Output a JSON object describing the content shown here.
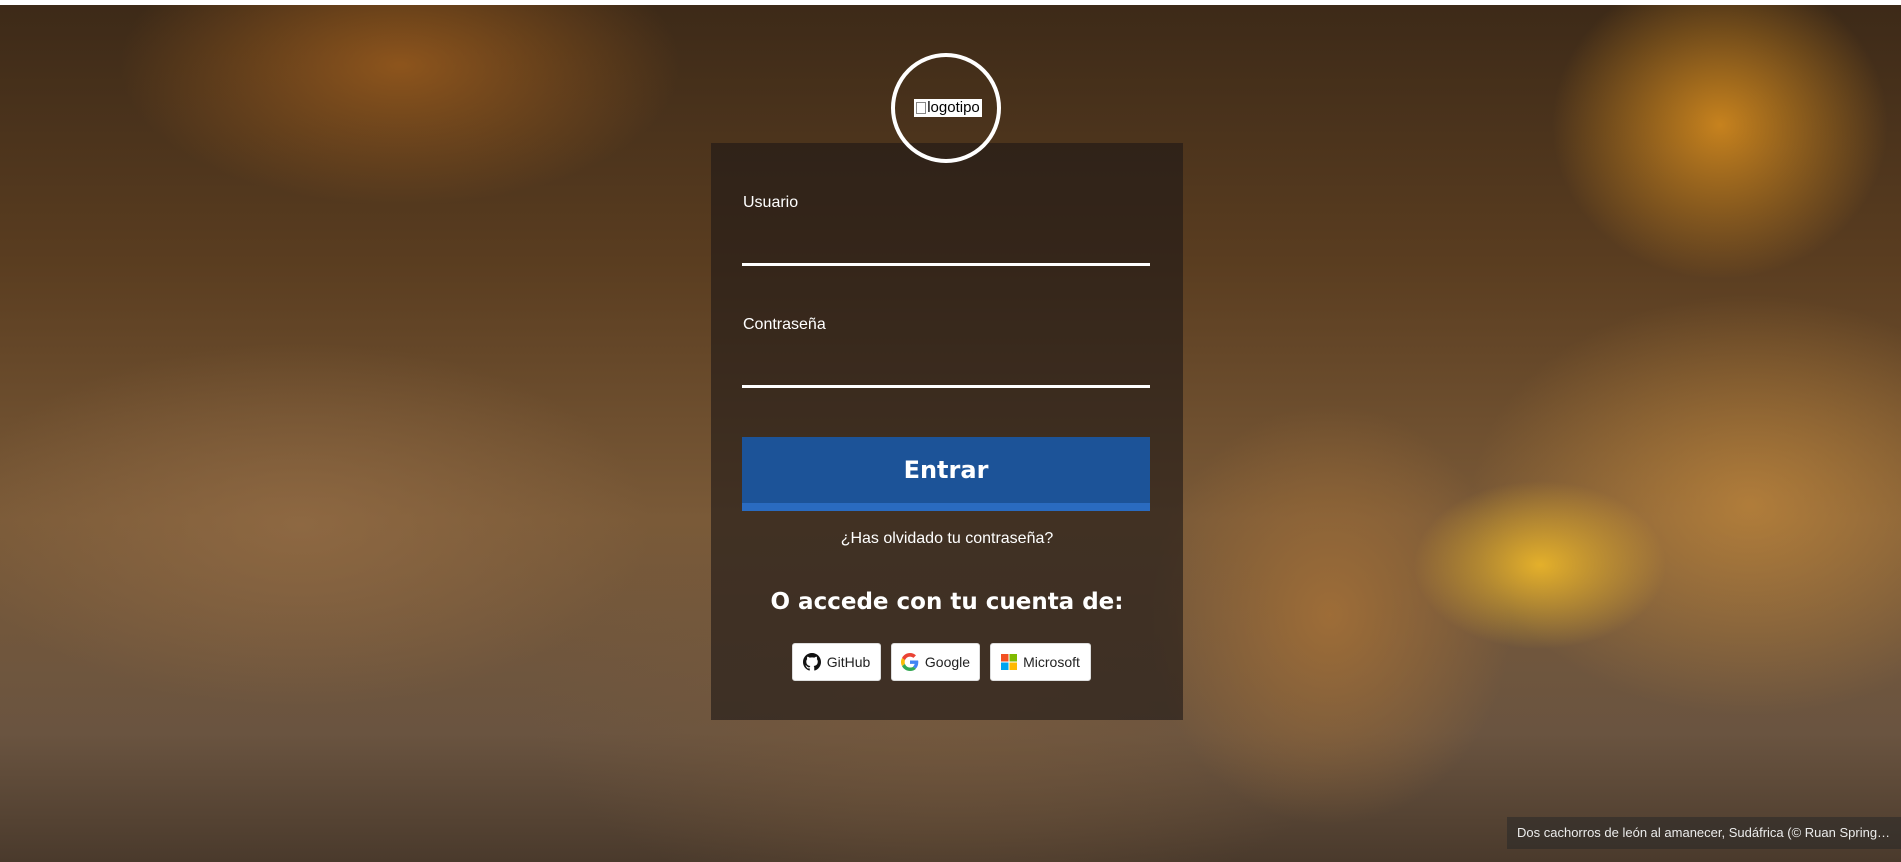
{
  "background": {
    "caption": "Dos cachorros de león al amanecer, Sudáfrica (© Ruan Springor…"
  },
  "logo": {
    "alt_text": "logotipo",
    "icon": "broken-image-icon"
  },
  "form": {
    "username_label": "Usuario",
    "username_value": "",
    "password_label": "Contraseña",
    "password_value": "",
    "submit_label": "Entrar",
    "forgot_password": "¿Has olvidado tu contraseña?"
  },
  "social": {
    "heading": "O accede con tu cuenta de:",
    "providers": [
      {
        "label": "GitHub",
        "icon": "github-icon"
      },
      {
        "label": "Google",
        "icon": "google-icon"
      },
      {
        "label": "Microsoft",
        "icon": "microsoft-icon"
      }
    ]
  },
  "colors": {
    "primary_button": "#1c5398",
    "primary_button_border": "#2a6bc0",
    "text": "#ffffff"
  }
}
